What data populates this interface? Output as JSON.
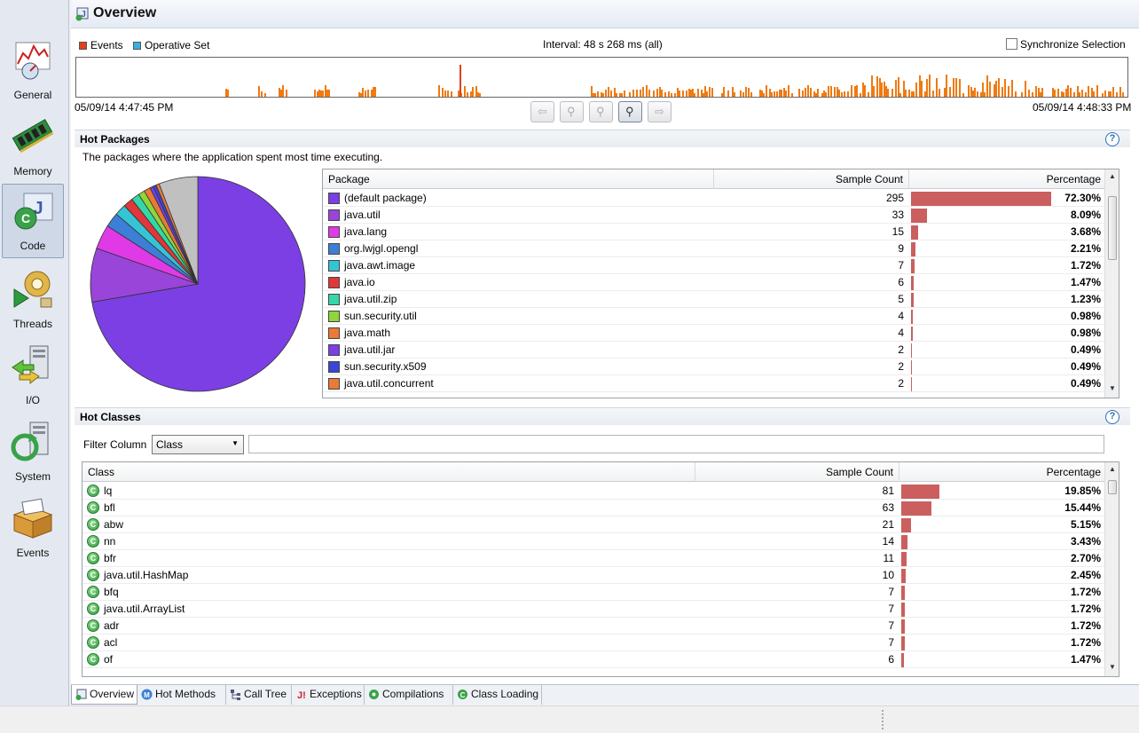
{
  "title": "Overview",
  "sidebar": {
    "items": [
      {
        "label": "General"
      },
      {
        "label": "Memory"
      },
      {
        "label": "Code"
      },
      {
        "label": "Threads"
      },
      {
        "label": "I/O"
      },
      {
        "label": "System"
      },
      {
        "label": "Events"
      }
    ]
  },
  "timeline": {
    "legend_events": "Events",
    "legend_operative": "Operative Set",
    "interval": "Interval: 48 s 268 ms (all)",
    "sync_label": "Synchronize Selection",
    "start_time": "05/09/14 4:47:45 PM",
    "end_time": "05/09/14 4:48:33 PM"
  },
  "hot_packages": {
    "title": "Hot Packages",
    "description": "The packages where the application spent most time executing.",
    "col_package": "Package",
    "col_count": "Sample Count",
    "col_pct": "Percentage",
    "rows": [
      {
        "name": "(default package)",
        "count": "295",
        "pct": "72.30%",
        "frac": 0.723,
        "color": "#7b3fe4"
      },
      {
        "name": "java.util",
        "count": "33",
        "pct": "8.09%",
        "frac": 0.0809,
        "color": "#9a45d9"
      },
      {
        "name": "java.lang",
        "count": "15",
        "pct": "3.68%",
        "frac": 0.0368,
        "color": "#e03ae6"
      },
      {
        "name": "org.lwjgl.opengl",
        "count": "9",
        "pct": "2.21%",
        "frac": 0.0221,
        "color": "#3d7fd6"
      },
      {
        "name": "java.awt.image",
        "count": "7",
        "pct": "1.72%",
        "frac": 0.0172,
        "color": "#35c4d6"
      },
      {
        "name": "java.io",
        "count": "6",
        "pct": "1.47%",
        "frac": 0.0147,
        "color": "#e0373a"
      },
      {
        "name": "java.util.zip",
        "count": "5",
        "pct": "1.23%",
        "frac": 0.0123,
        "color": "#35d6a7"
      },
      {
        "name": "sun.security.util",
        "count": "4",
        "pct": "0.98%",
        "frac": 0.0098,
        "color": "#8fd63a"
      },
      {
        "name": "java.math",
        "count": "4",
        "pct": "0.98%",
        "frac": 0.0098,
        "color": "#ea7a35"
      },
      {
        "name": "java.util.jar",
        "count": "2",
        "pct": "0.49%",
        "frac": 0.0049,
        "color": "#7b3fe4"
      },
      {
        "name": "sun.security.x509",
        "count": "2",
        "pct": "0.49%",
        "frac": 0.0049,
        "color": "#3d45d6"
      },
      {
        "name": "java.util.concurrent",
        "count": "2",
        "pct": "0.49%",
        "frac": 0.0049,
        "color": "#ea7a35"
      }
    ]
  },
  "hot_classes": {
    "title": "Hot Classes",
    "filter_label": "Filter Column",
    "filter_value": "Class",
    "col_class": "Class",
    "col_count": "Sample Count",
    "col_pct": "Percentage",
    "rows": [
      {
        "name": "lq",
        "count": "81",
        "pct": "19.85%",
        "frac": 0.1985
      },
      {
        "name": "bfl",
        "count": "63",
        "pct": "15.44%",
        "frac": 0.1544
      },
      {
        "name": "abw",
        "count": "21",
        "pct": "5.15%",
        "frac": 0.0515
      },
      {
        "name": "nn",
        "count": "14",
        "pct": "3.43%",
        "frac": 0.0343
      },
      {
        "name": "bfr",
        "count": "11",
        "pct": "2.70%",
        "frac": 0.027
      },
      {
        "name": "java.util.HashMap",
        "count": "10",
        "pct": "2.45%",
        "frac": 0.0245
      },
      {
        "name": "bfq",
        "count": "7",
        "pct": "1.72%",
        "frac": 0.0172
      },
      {
        "name": "java.util.ArrayList",
        "count": "7",
        "pct": "1.72%",
        "frac": 0.0172
      },
      {
        "name": "adr",
        "count": "7",
        "pct": "1.72%",
        "frac": 0.0172
      },
      {
        "name": "acl",
        "count": "7",
        "pct": "1.72%",
        "frac": 0.0172
      },
      {
        "name": "of",
        "count": "6",
        "pct": "1.47%",
        "frac": 0.0147
      }
    ]
  },
  "tabs": [
    {
      "label": "Overview"
    },
    {
      "label": "Hot Methods"
    },
    {
      "label": "Call Tree"
    },
    {
      "label": "Exceptions"
    },
    {
      "label": "Compilations"
    },
    {
      "label": "Class Loading"
    }
  ],
  "colors": {
    "events": "#e0401a",
    "operative": "#3ab0e0",
    "bar": "#cb5f5f",
    "timeline_bar": "#f07a10"
  }
}
